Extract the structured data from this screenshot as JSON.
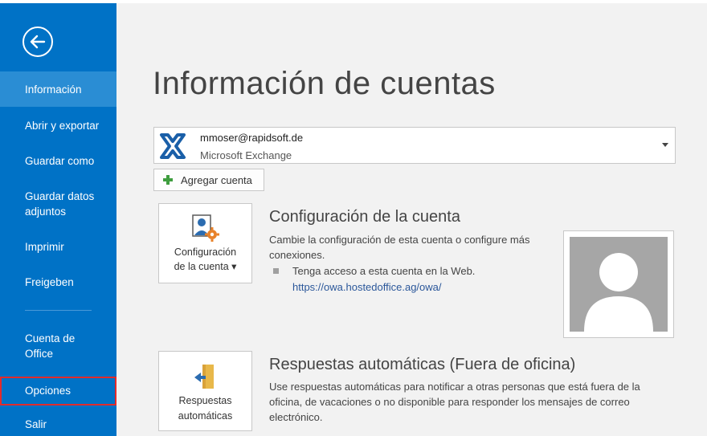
{
  "sidebar": {
    "items": [
      {
        "label": "Información"
      },
      {
        "label": "Abrir y exportar"
      },
      {
        "label": "Guardar como"
      },
      {
        "label": "Guardar datos adjuntos"
      },
      {
        "label": "Imprimir"
      },
      {
        "label": "Freigeben"
      },
      {
        "label": "Cuenta de Office"
      },
      {
        "label": "Opciones"
      },
      {
        "label": "Salir"
      }
    ]
  },
  "main": {
    "title": "Información de cuentas",
    "account": {
      "email": "mmoser@rapidsoft.de",
      "type": "Microsoft Exchange"
    },
    "add_account_label": "Agregar cuenta",
    "account_settings": {
      "button_line1": "Configuración",
      "button_line2": "de la cuenta ▾",
      "title": "Configuración de la cuenta",
      "description": "Cambie la configuración de esta cuenta o configure más conexiones.",
      "bullet": "Tenga acceso a esta cuenta en la Web.",
      "link": "https://owa.hostedoffice.ag/owa/"
    },
    "auto_replies": {
      "button_line1": "Respuestas",
      "button_line2": "automáticas",
      "title": "Respuestas automáticas (Fuera de oficina)",
      "description": "Use respuestas automáticas para notificar a otras personas que está fuera de la oficina, de vacaciones o no disponible para responder los mensajes de correo electrónico."
    }
  },
  "colors": {
    "sidebar": "#0072c6",
    "sidebar_active": "#2a8dd4",
    "highlight": "#e32b2b",
    "link": "#2b579a"
  }
}
